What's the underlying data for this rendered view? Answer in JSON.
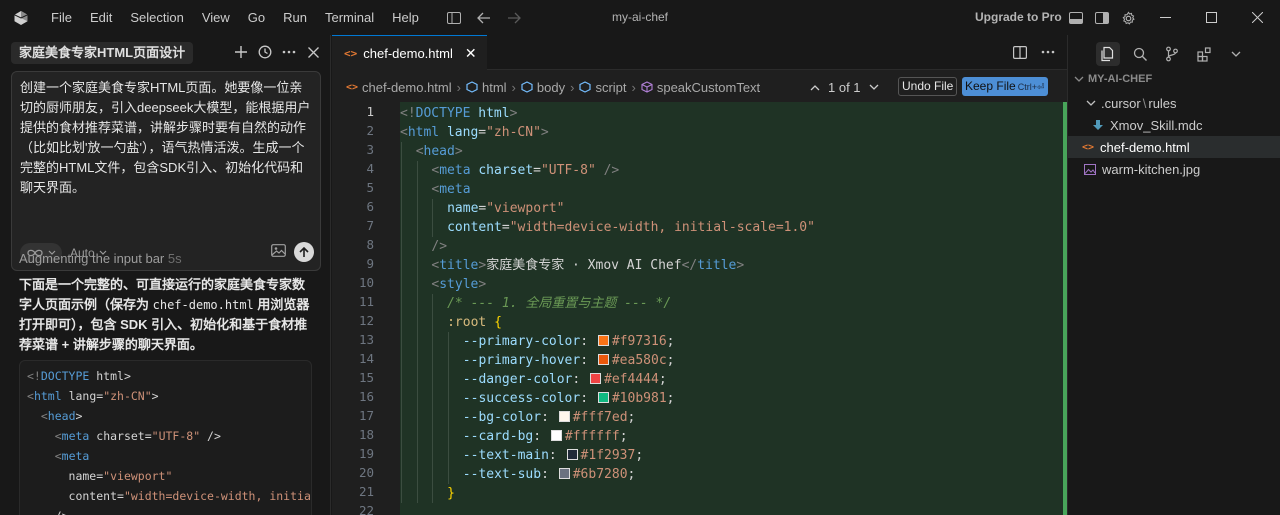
{
  "titlebar": {
    "menu": [
      "File",
      "Edit",
      "Selection",
      "View",
      "Go",
      "Run",
      "Terminal",
      "Help"
    ],
    "window_title": "my-ai-chef",
    "upgrade_label": "Upgrade to Pro"
  },
  "chat": {
    "tab_title": "家庭美食专家HTML页面设计",
    "prompt": "创建一个家庭美食专家HTML页面。她要像一位亲切的厨师朋友，引入deepseek大模型，能根据用户提供的食材推荐菜谱，讲解步骤时要有自然的动作（比如比划'放一勺盐'），语气热情活泼。生成一个完整的HTML文件，包含SDK引入、初始化代码和聊天界面。",
    "mode_label": "Auto",
    "status_label": "Augmenting the input bar",
    "status_time": "5s",
    "answer_part1": "下面是一个完整的、可直接运行的家庭美食专家数字人页面示例（保存为 ",
    "answer_file": "chef-demo.html",
    "answer_part2": " 用浏览器打开即可），包含 SDK 引入、初始化和基于食材推荐菜谱 + 讲解步骤的聊天界面。",
    "code_lines": [
      "<!DOCTYPE html>",
      "<html lang=\"zh-CN\">",
      "  <head>",
      "    <meta charset=\"UTF-8\" />",
      "    <meta",
      "      name=\"viewport\"",
      "      content=\"width=device-width, initial-",
      "    />"
    ]
  },
  "editor": {
    "tab_name": "chef-demo.html",
    "breadcrumbs": [
      "chef-demo.html",
      "html",
      "body",
      "script",
      "speakCustomText"
    ],
    "match_count": "1 of 1",
    "undo_label": "Undo File",
    "keep_label": "Keep File",
    "keep_shortcut": "Ctrl+⏎",
    "active_line": 1,
    "lines": [
      {
        "n": "1",
        "indent": 0,
        "parts": [
          [
            "t-punc",
            "<!"
          ],
          [
            "t-tag",
            "DOCTYPE"
          ],
          [
            "t-text",
            " "
          ],
          [
            "t-attr",
            "html"
          ],
          [
            "t-punc",
            ">"
          ]
        ]
      },
      {
        "n": "2",
        "indent": 0,
        "parts": [
          [
            "t-punc",
            "<"
          ],
          [
            "t-tag",
            "html"
          ],
          [
            "t-text",
            " "
          ],
          [
            "t-attr",
            "lang"
          ],
          [
            "t-text",
            "="
          ],
          [
            "t-str",
            "\"zh-CN\""
          ],
          [
            "t-punc",
            ">"
          ]
        ]
      },
      {
        "n": "3",
        "indent": 1,
        "parts": [
          [
            "t-punc",
            "<"
          ],
          [
            "t-tag",
            "head"
          ],
          [
            "t-punc",
            ">"
          ]
        ]
      },
      {
        "n": "4",
        "indent": 2,
        "parts": [
          [
            "t-punc",
            "<"
          ],
          [
            "t-tag",
            "meta"
          ],
          [
            "t-text",
            " "
          ],
          [
            "t-attr",
            "charset"
          ],
          [
            "t-text",
            "="
          ],
          [
            "t-str",
            "\"UTF-8\""
          ],
          [
            "t-text",
            " "
          ],
          [
            "t-punc",
            "/>"
          ]
        ]
      },
      {
        "n": "5",
        "indent": 2,
        "parts": [
          [
            "t-punc",
            "<"
          ],
          [
            "t-tag",
            "meta"
          ]
        ]
      },
      {
        "n": "6",
        "indent": 3,
        "parts": [
          [
            "t-attr",
            "name"
          ],
          [
            "t-text",
            "="
          ],
          [
            "t-str",
            "\"viewport\""
          ]
        ]
      },
      {
        "n": "7",
        "indent": 3,
        "parts": [
          [
            "t-attr",
            "content"
          ],
          [
            "t-text",
            "="
          ],
          [
            "t-str",
            "\"width=device-width, initial-scale=1.0\""
          ]
        ]
      },
      {
        "n": "8",
        "indent": 2,
        "parts": [
          [
            "t-punc",
            "/>"
          ]
        ]
      },
      {
        "n": "9",
        "indent": 2,
        "parts": [
          [
            "t-punc",
            "<"
          ],
          [
            "t-tag",
            "title"
          ],
          [
            "t-punc",
            ">"
          ],
          [
            "t-text",
            "家庭美食专家 · Xmov AI Chef"
          ],
          [
            "t-punc",
            "</"
          ],
          [
            "t-tag",
            "title"
          ],
          [
            "t-punc",
            ">"
          ]
        ]
      },
      {
        "n": "10",
        "indent": 2,
        "parts": [
          [
            "t-punc",
            "<"
          ],
          [
            "t-tag",
            "style"
          ],
          [
            "t-punc",
            ">"
          ]
        ]
      },
      {
        "n": "11",
        "indent": 3,
        "parts": [
          [
            "t-comment",
            "/* --- 1. 全局重置与主题 --- */"
          ]
        ]
      },
      {
        "n": "12",
        "indent": 3,
        "parts": [
          [
            "t-sel",
            ":root"
          ],
          [
            "t-text",
            " "
          ],
          [
            "t-brace",
            "{"
          ]
        ]
      },
      {
        "n": "13",
        "indent": 4,
        "parts": [
          [
            "t-prop",
            "--primary-color"
          ],
          [
            "t-text",
            ": "
          ],
          [
            "swatch",
            "#f97316"
          ],
          [
            "t-val",
            "#f97316"
          ],
          [
            "t-text",
            ";"
          ]
        ]
      },
      {
        "n": "14",
        "indent": 4,
        "parts": [
          [
            "t-prop",
            "--primary-hover"
          ],
          [
            "t-text",
            ": "
          ],
          [
            "swatch",
            "#ea580c"
          ],
          [
            "t-val",
            "#ea580c"
          ],
          [
            "t-text",
            ";"
          ]
        ]
      },
      {
        "n": "15",
        "indent": 4,
        "parts": [
          [
            "t-prop",
            "--danger-color"
          ],
          [
            "t-text",
            ": "
          ],
          [
            "swatch",
            "#ef4444"
          ],
          [
            "t-val",
            "#ef4444"
          ],
          [
            "t-text",
            ";"
          ]
        ]
      },
      {
        "n": "16",
        "indent": 4,
        "parts": [
          [
            "t-prop",
            "--success-color"
          ],
          [
            "t-text",
            ": "
          ],
          [
            "swatch",
            "#10b981"
          ],
          [
            "t-val",
            "#10b981"
          ],
          [
            "t-text",
            ";"
          ]
        ]
      },
      {
        "n": "17",
        "indent": 4,
        "parts": [
          [
            "t-prop",
            "--bg-color"
          ],
          [
            "t-text",
            ": "
          ],
          [
            "swatch",
            "#fff7ed"
          ],
          [
            "t-val",
            "#fff7ed"
          ],
          [
            "t-text",
            ";"
          ]
        ]
      },
      {
        "n": "18",
        "indent": 4,
        "parts": [
          [
            "t-prop",
            "--card-bg"
          ],
          [
            "t-text",
            ": "
          ],
          [
            "swatch",
            "#ffffff"
          ],
          [
            "t-val",
            "#ffffff"
          ],
          [
            "t-text",
            ";"
          ]
        ]
      },
      {
        "n": "19",
        "indent": 4,
        "parts": [
          [
            "t-prop",
            "--text-main"
          ],
          [
            "t-text",
            ": "
          ],
          [
            "swatch",
            "#1f2937"
          ],
          [
            "t-val",
            "#1f2937"
          ],
          [
            "t-text",
            ";"
          ]
        ]
      },
      {
        "n": "20",
        "indent": 4,
        "parts": [
          [
            "t-prop",
            "--text-sub"
          ],
          [
            "t-text",
            ": "
          ],
          [
            "swatch",
            "#6b7280"
          ],
          [
            "t-val",
            "#6b7280"
          ],
          [
            "t-text",
            ";"
          ]
        ]
      },
      {
        "n": "21",
        "indent": 3,
        "parts": [
          [
            "t-brace",
            "}"
          ]
        ]
      },
      {
        "n": "22",
        "indent": 0,
        "parts": []
      }
    ]
  },
  "explorer": {
    "project": "MY-AI-CHEF",
    "folder": ".cursor",
    "subfolder": "rules",
    "items": [
      {
        "name": "Xmov_Skill.mdc",
        "type": "mdc"
      },
      {
        "name": "chef-demo.html",
        "type": "html",
        "selected": true
      },
      {
        "name": "warm-kitchen.jpg",
        "type": "image"
      }
    ]
  },
  "colors": {
    "accent": "#0078d4",
    "diff_green": "#48a55a",
    "diff_bg": "#1f3325"
  }
}
